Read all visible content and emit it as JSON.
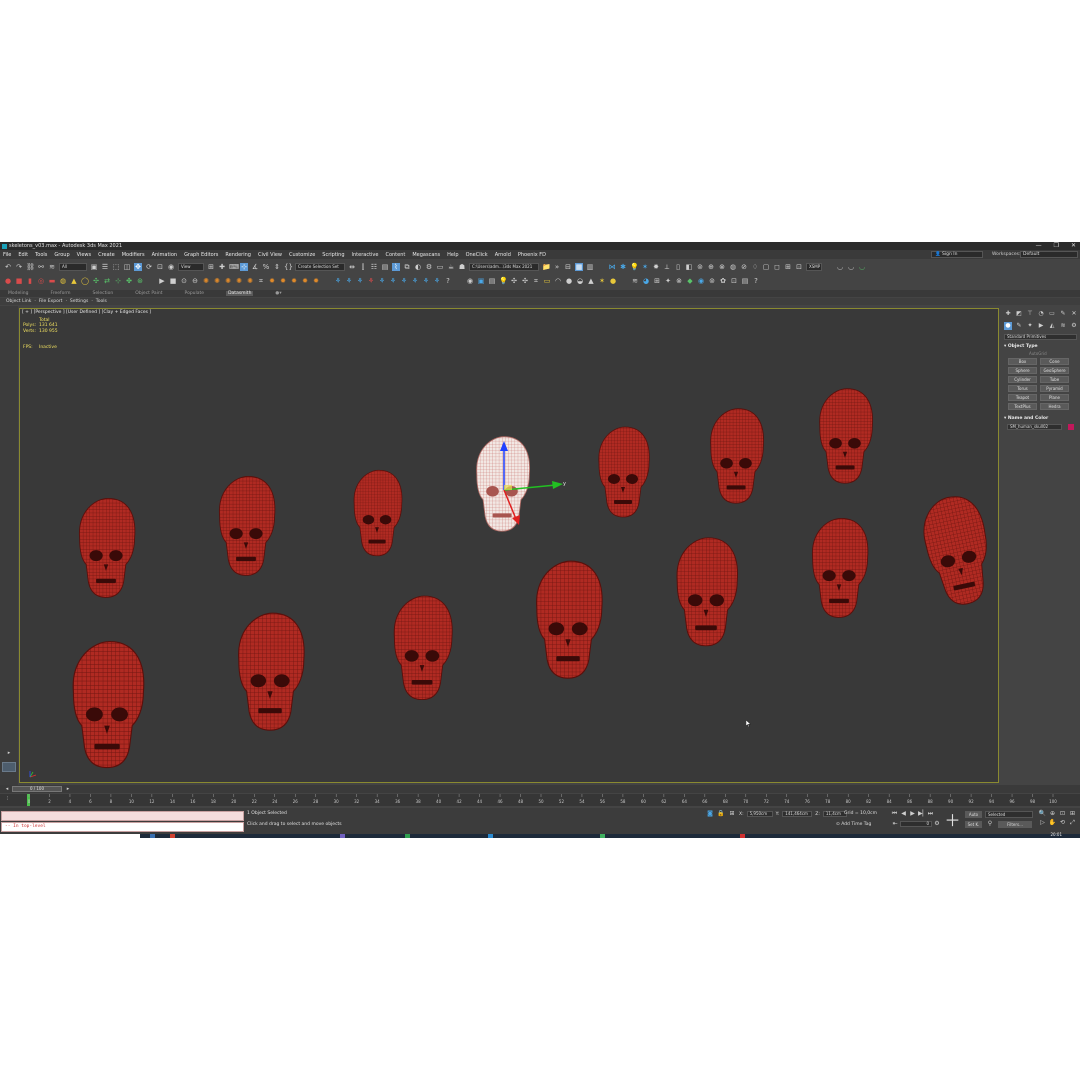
{
  "window": {
    "title": "skeletons_v03.max - Autodesk 3ds Max 2021",
    "controls": [
      "—",
      "❐",
      "✕"
    ]
  },
  "menu": [
    "File",
    "Edit",
    "Tools",
    "Group",
    "Views",
    "Create",
    "Modifiers",
    "Animation",
    "Graph Editors",
    "Rendering",
    "Civil View",
    "Customize",
    "Scripting",
    "Interactive",
    "Content",
    "Megascans",
    "Help",
    "OneClick",
    "Arnold",
    "Phoenix FD"
  ],
  "account": {
    "sign_in": "Sign In",
    "workspaces_label": "Workspaces:",
    "workspace": "Default"
  },
  "toolbar": {
    "selection_filter": "All",
    "ref_coord": "View",
    "named_selection": "Create Selection Set",
    "project_path": "C:\\Users\\adm...\\3ds Max 2021",
    "xsmp": "XSMP"
  },
  "ribbon": {
    "tabs": [
      "Modeling",
      "Freeform",
      "Selection",
      "Object Paint",
      "Populate",
      "Datasmith"
    ],
    "active": "Datasmith"
  },
  "subbar": {
    "items": [
      "Object Link",
      "·",
      "File Export",
      "·",
      "Settings",
      "·",
      "Tools"
    ]
  },
  "viewport": {
    "label": "[ + ] [Perspective ] [User Defined ] [Clay + Edged Faces ]",
    "stats": {
      "total_label": "Total",
      "polys_label": "Polys:",
      "polys": "131 641",
      "verts_label": "Verts:",
      "verts": "130 955",
      "fps_label": "FPS:",
      "fps": "Inactive"
    },
    "skull_color": "#b02a22",
    "selected_color": "#f2e8e4",
    "gizmo_y_label": "y"
  },
  "command_panel": {
    "category": "Standard Primitives",
    "object_type_title": "Object Type",
    "autogrid": "AutoGrid",
    "buttons": [
      "Box",
      "Cone",
      "Sphere",
      "GeoSphere",
      "Cylinder",
      "Tube",
      "Torus",
      "Pyramid",
      "Teapot",
      "Plane",
      "TextPlus",
      "Hedra"
    ],
    "name_color_title": "Name and Color",
    "object_name": "SM_human_skull02",
    "object_color": "#c2185b"
  },
  "timeline": {
    "frame_display": "0 / 100",
    "ticks": [
      0,
      2,
      4,
      6,
      8,
      10,
      12,
      14,
      16,
      18,
      20,
      22,
      24,
      26,
      28,
      30,
      32,
      34,
      36,
      38,
      40,
      42,
      44,
      46,
      48,
      50,
      52,
      54,
      56,
      58,
      60,
      62,
      64,
      66,
      68,
      70,
      72,
      74,
      76,
      78,
      80,
      82,
      84,
      86,
      88,
      90,
      92,
      94,
      96,
      98,
      100
    ]
  },
  "status": {
    "maxscript_output": "-- In top-level",
    "selection": "1 Object Selected",
    "hint": "Click and drag to select and move objects",
    "x_label": "X:",
    "x": "5,950cm",
    "y_label": "Y:",
    "y": "141,464cm",
    "z_label": "Z:",
    "z": "11,4cm",
    "grid": "Grid = 10,0cm",
    "add_time_tag": "Add Time Tag",
    "frame": "0",
    "auto": "Auto",
    "set_k": "Set K.",
    "selected": "Selected",
    "filters": "Filters..."
  },
  "taskbar": {
    "clock": "20:01"
  }
}
